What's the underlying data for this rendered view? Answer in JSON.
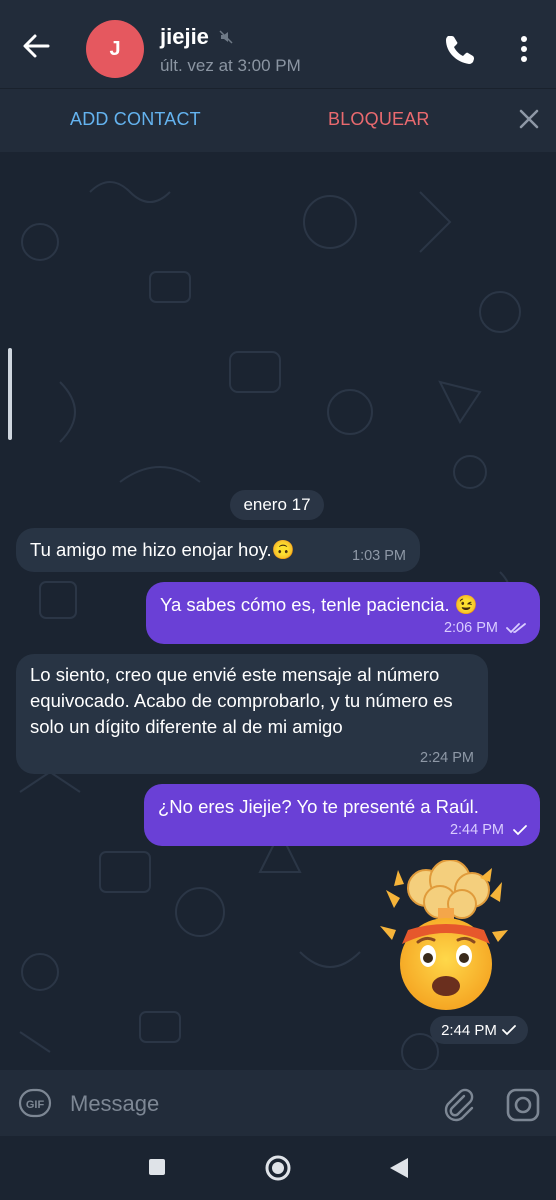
{
  "header": {
    "back_icon": "arrow-left-icon",
    "avatar_letter": "J",
    "avatar_color": "#e5585f",
    "name": "jiejie",
    "muted_icon": "muted-speaker-icon",
    "last_seen": "últ. vez at 3:00 PM",
    "call_icon": "phone-icon",
    "menu_icon": "vertical-dots-icon"
  },
  "actionbar": {
    "add_contact": "ADD CONTACT",
    "block": "BLOQUEAR",
    "close_icon": "close-icon"
  },
  "chat": {
    "date_separator": "enero 17",
    "messages": [
      {
        "direction": "incoming",
        "text": "Tu amigo me hizo enojar hoy.🙃",
        "time": "1:03 PM"
      },
      {
        "direction": "outgoing",
        "text": "Ya sabes cómo es, tenle paciencia. 😉",
        "time": "2:06 PM",
        "status": "read-double-check"
      },
      {
        "direction": "incoming",
        "text": "Lo siento, creo que envié este mensaje al número equivocado. Acabo de comprobarlo, y tu número es solo un dígito diferente al de mi amigo",
        "time": "2:24 PM"
      },
      {
        "direction": "outgoing",
        "text": "¿No eres Jiejie?  Yo te presenté a Raúl.",
        "time": "2:44 PM",
        "status": "sent-single-check"
      },
      {
        "direction": "outgoing",
        "sticker": "exploding-head-emoji",
        "time": "2:44 PM",
        "status": "sent-single-check"
      }
    ]
  },
  "composer": {
    "gif_icon": "gif-icon",
    "placeholder": "Message",
    "attach_icon": "paperclip-icon",
    "camera_icon": "camera-icon"
  },
  "navbar": {
    "recents_icon": "square-icon",
    "home_icon": "circle-home-icon",
    "back_icon": "triangle-back-icon"
  },
  "colors": {
    "accent_link": "#64b3ef",
    "danger": "#ea6a6f",
    "outgoing_bubble": "#6a40d6",
    "incoming_bubble": "#283444",
    "background": "#1b2431"
  }
}
